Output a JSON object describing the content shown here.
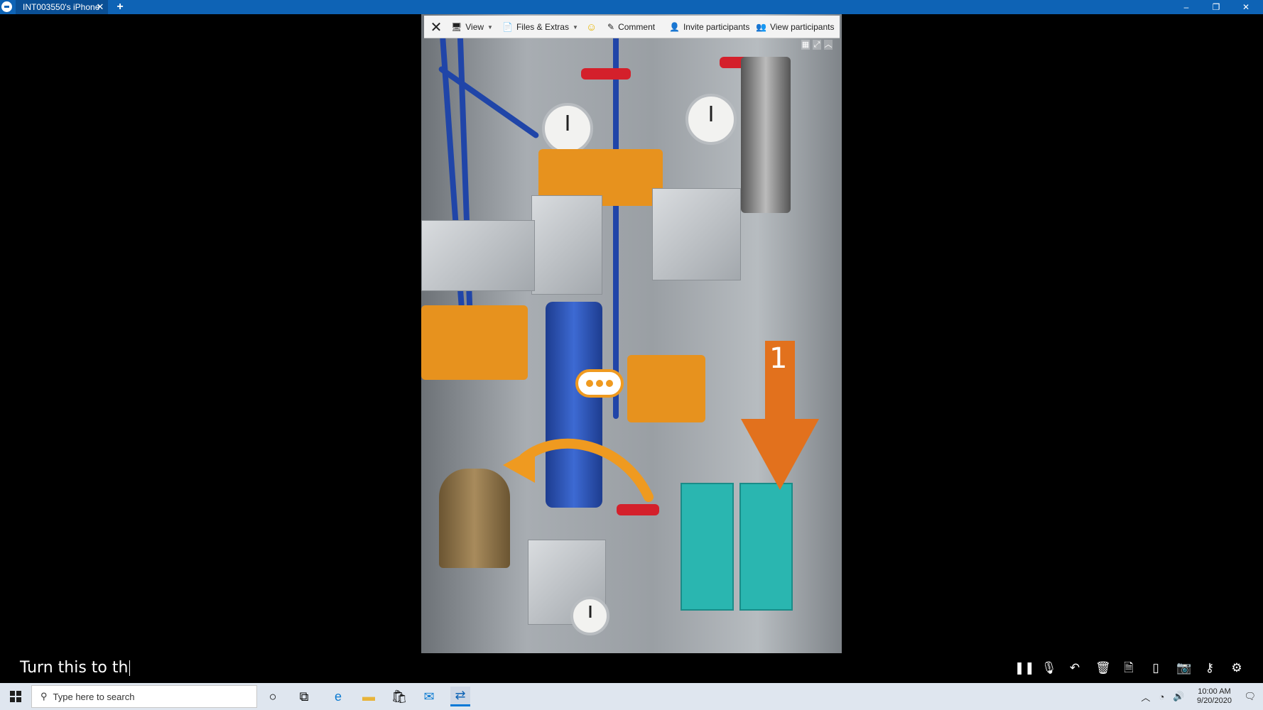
{
  "titlebar": {
    "tab_label": "INT003550's iPhone",
    "tab_close": "✕",
    "tab_add": "+",
    "minimize": "–",
    "restore": "❐",
    "close": "✕"
  },
  "toolbar": {
    "view_label": "View",
    "files_label": "Files & Extras",
    "comment_label": "Comment",
    "invite_label": "Invite participants",
    "view_participants_label": "View participants"
  },
  "annotations": {
    "arrow_number": "1"
  },
  "caption": {
    "text": "Turn this to th"
  },
  "taskbar": {
    "search_placeholder": "Type here to search",
    "time": "10:00 AM",
    "date": "9/20/2020"
  },
  "colors": {
    "titlebar": "#0e63b5",
    "annotation": "#ef9a20",
    "arrow": "#e2711d",
    "taskbar": "#dfe6ef"
  }
}
